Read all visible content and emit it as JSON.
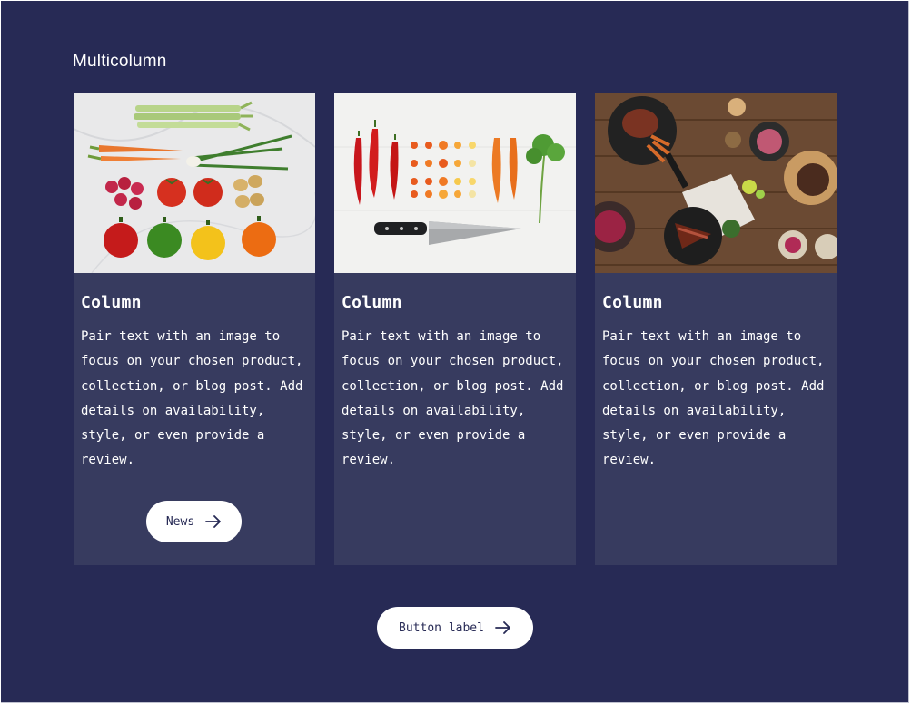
{
  "section": {
    "title": "Multicolumn"
  },
  "columns": [
    {
      "image_icon": "vegetables-photo",
      "heading": "Column",
      "text": "Pair text with an image to focus on your chosen product, collection, or blog post. Add details on availability, style, or even provide a review.",
      "button_label": "News",
      "button_icon": "arrow-right-icon"
    },
    {
      "image_icon": "peppers-and-knife-photo",
      "heading": "Column",
      "text": "Pair text with an image to focus on your chosen product, collection, or blog post. Add details on availability, style, or even provide a review."
    },
    {
      "image_icon": "table-feast-photo",
      "heading": "Column",
      "text": "Pair text with an image to focus on your chosen product, collection, or blog post. Add details on availability, style, or even provide a review."
    }
  ],
  "footer": {
    "button_label": "Button label",
    "button_icon": "arrow-right-icon"
  },
  "colors": {
    "background": "#272a55",
    "card": "#373b5f",
    "button": "#ffffff",
    "text": "#ffffff"
  }
}
